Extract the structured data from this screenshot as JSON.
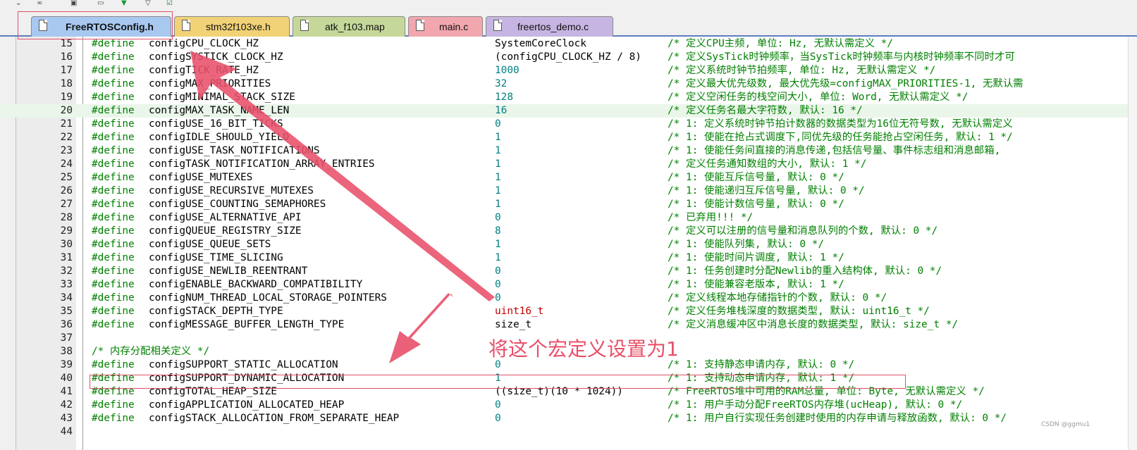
{
  "toolbar": {
    "icons": [
      "dropdown-icon",
      "binoculars-icon",
      "build-icon",
      "window-icon",
      "download-arrow-icon",
      "filter-icon",
      "check-window-icon"
    ]
  },
  "tabs": [
    {
      "label": "FreeRTOSConfig.h",
      "active": true,
      "color": "#a8c8f0"
    },
    {
      "label": "stm32f103xe.h",
      "active": false,
      "color": "#f2d277"
    },
    {
      "label": "atk_f103.map",
      "active": false,
      "color": "#c5d89a"
    },
    {
      "label": "main.c",
      "active": false,
      "color": "#f2a6ad"
    },
    {
      "label": "freertos_demo.c",
      "active": false,
      "color": "#c6b5e2"
    }
  ],
  "code": {
    "lines": [
      {
        "n": "15",
        "kw": "#define",
        "name": "configCPU_CLOCK_HZ",
        "value": "SystemCoreClock",
        "cls": "black",
        "comment": "/* 定义CPU主频, 单位: Hz, 无默认需定义 */"
      },
      {
        "n": "16",
        "kw": "#define",
        "name": "configSYSTICK_CLOCK_HZ",
        "value": "(configCPU_CLOCK_HZ / 8)",
        "cls": "black",
        "comment": "/* 定义SysTick时钟频率，当SysTick时钟频率与内核时钟频率不同时才可"
      },
      {
        "n": "17",
        "kw": "#define",
        "name": "configTICK_RATE_HZ",
        "value": "1000",
        "cls": "",
        "comment": "/* 定义系统时钟节拍频率, 单位: Hz, 无默认需定义 */"
      },
      {
        "n": "18",
        "kw": "#define",
        "name": "configMAX_PRIORITIES",
        "value": "32",
        "cls": "",
        "comment": "/* 定义最大优先级数, 最大优先级=configMAX_PRIORITIES-1, 无默认需"
      },
      {
        "n": "19",
        "kw": "#define",
        "name": "configMINIMAL_STACK_SIZE",
        "value": "128",
        "cls": "",
        "comment": "/* 定义空闲任务的栈空间大小, 单位: Word, 无默认需定义 */"
      },
      {
        "n": "20",
        "kw": "#define",
        "name": "configMAX_TASK_NAME_LEN",
        "value": "16",
        "cls": "",
        "comment": "/* 定义任务名最大字符数, 默认: 16 */"
      },
      {
        "n": "21",
        "kw": "#define",
        "name": "configUSE_16_BIT_TICKS",
        "value": "0",
        "cls": "",
        "comment": "/* 1: 定义系统时钟节拍计数器的数据类型为16位无符号数, 无默认需定义"
      },
      {
        "n": "22",
        "kw": "#define",
        "name": "configIDLE_SHOULD_YIELD",
        "value": "1",
        "cls": "",
        "comment": "/* 1: 使能在抢占式调度下,同优先级的任务能抢占空闲任务, 默认: 1 */"
      },
      {
        "n": "23",
        "kw": "#define",
        "name": "configUSE_TASK_NOTIFICATIONS",
        "value": "1",
        "cls": "",
        "comment": "/* 1: 使能任务间直接的消息传递,包括信号量、事件标志组和消息邮箱,"
      },
      {
        "n": "24",
        "kw": "#define",
        "name": "configTASK_NOTIFICATION_ARRAY_ENTRIES",
        "value": "1",
        "cls": "",
        "comment": "/* 定义任务通知数组的大小, 默认: 1 */"
      },
      {
        "n": "25",
        "kw": "#define",
        "name": "configUSE_MUTEXES",
        "value": "1",
        "cls": "",
        "comment": "/* 1: 使能互斥信号量, 默认: 0 */"
      },
      {
        "n": "26",
        "kw": "#define",
        "name": "configUSE_RECURSIVE_MUTEXES",
        "value": "1",
        "cls": "",
        "comment": "/* 1: 使能递归互斥信号量, 默认: 0 */"
      },
      {
        "n": "27",
        "kw": "#define",
        "name": "configUSE_COUNTING_SEMAPHORES",
        "value": "1",
        "cls": "",
        "comment": "/* 1: 使能计数信号量, 默认: 0 */"
      },
      {
        "n": "28",
        "kw": "#define",
        "name": "configUSE_ALTERNATIVE_API",
        "value": "0",
        "cls": "",
        "comment": "/* 已弃用!!! */"
      },
      {
        "n": "29",
        "kw": "#define",
        "name": "configQUEUE_REGISTRY_SIZE",
        "value": "8",
        "cls": "",
        "comment": "/* 定义可以注册的信号量和消息队列的个数, 默认: 0 */"
      },
      {
        "n": "30",
        "kw": "#define",
        "name": "configUSE_QUEUE_SETS",
        "value": "1",
        "cls": "",
        "comment": "/* 1: 使能队列集, 默认: 0 */"
      },
      {
        "n": "31",
        "kw": "#define",
        "name": "configUSE_TIME_SLICING",
        "value": "1",
        "cls": "",
        "comment": "/* 1: 使能时间片调度, 默认: 1 */"
      },
      {
        "n": "32",
        "kw": "#define",
        "name": "configUSE_NEWLIB_REENTRANT",
        "value": "0",
        "cls": "",
        "comment": "/* 1: 任务创建时分配Newlib的重入结构体, 默认: 0 */"
      },
      {
        "n": "33",
        "kw": "#define",
        "name": "configENABLE_BACKWARD_COMPATIBILITY",
        "value": "0",
        "cls": "",
        "comment": "/* 1: 使能兼容老版本, 默认: 1 */"
      },
      {
        "n": "34",
        "kw": "#define",
        "name": "configNUM_THREAD_LOCAL_STORAGE_POINTERS",
        "value": "0",
        "cls": "",
        "comment": "/* 定义线程本地存储指针的个数, 默认: 0 */"
      },
      {
        "n": "35",
        "kw": "#define",
        "name": "configSTACK_DEPTH_TYPE",
        "value": "uint16_t",
        "cls": "red",
        "comment": "/* 定义任务堆栈深度的数据类型, 默认: uint16_t */"
      },
      {
        "n": "36",
        "kw": "#define",
        "name": "configMESSAGE_BUFFER_LENGTH_TYPE",
        "value": "size_t",
        "cls": "black",
        "comment": "/* 定义消息缓冲区中消息长度的数据类型, 默认: size_t */"
      },
      {
        "n": "37",
        "kw": "",
        "name": "",
        "value": "",
        "cls": "",
        "comment": ""
      },
      {
        "n": "38",
        "kw": "",
        "name": "",
        "value": "",
        "cls": "",
        "comment": "",
        "section": "/* 内存分配相关定义 */"
      },
      {
        "n": "39",
        "kw": "#define",
        "name": "configSUPPORT_STATIC_ALLOCATION",
        "value": "0",
        "cls": "",
        "comment": "/* 1: 支持静态申请内存, 默认: 0 */"
      },
      {
        "n": "40",
        "kw": "#define",
        "name": "configSUPPORT_DYNAMIC_ALLOCATION",
        "value": "1",
        "cls": "",
        "comment": "/* 1: 支持动态申请内存, 默认: 1 */"
      },
      {
        "n": "41",
        "kw": "#define",
        "name": "configTOTAL_HEAP_SIZE",
        "value": "((size_t)(10 * 1024))",
        "cls": "black",
        "comment": "/* FreeRTOS堆中可用的RAM总量, 单位: Byte, 无默认需定义 */"
      },
      {
        "n": "42",
        "kw": "#define",
        "name": "configAPPLICATION_ALLOCATED_HEAP",
        "value": "0",
        "cls": "",
        "comment": "/* 1: 用户手动分配FreeRTOS内存堆(ucHeap), 默认: 0 */"
      },
      {
        "n": "43",
        "kw": "#define",
        "name": "configSTACK_ALLOCATION_FROM_SEPARATE_HEAP",
        "value": "0",
        "cls": "",
        "comment": "/* 1: 用户自行实现任务创建时使用的内存申请与释放函数, 默认: 0 */"
      },
      {
        "n": "44",
        "kw": "",
        "name": "",
        "value": "",
        "cls": "",
        "comment": ""
      }
    ],
    "highlight_line": "20"
  },
  "annotation": {
    "text": "将这个宏定义设置为1",
    "color": "#e8506a"
  },
  "watermark": "CSDN @ggmu1"
}
